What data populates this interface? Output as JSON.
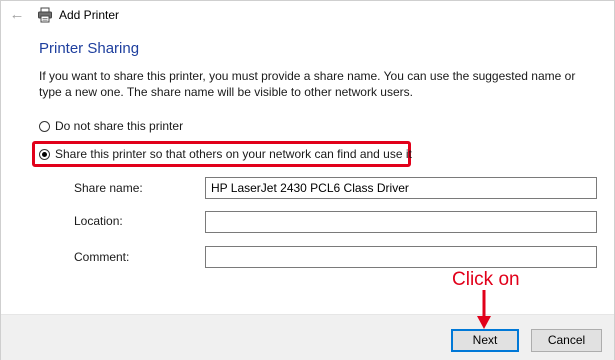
{
  "window": {
    "title": "Add Printer",
    "back_glyph": "←"
  },
  "page": {
    "heading": "Printer Sharing",
    "description": "If you want to share this printer, you must provide a share name. You can use the suggested name or type a new one. The share name will be visible to other network users."
  },
  "sharing_options": {
    "no_share_label": "Do not share this printer",
    "share_label": "Share this printer so that others on your network can find and use it",
    "selected": "share"
  },
  "fields": {
    "share_name_label": "Share name:",
    "share_name_value": "HP LaserJet 2430 PCL6 Class Driver",
    "location_label": "Location:",
    "location_value": "",
    "comment_label": "Comment:",
    "comment_value": ""
  },
  "buttons": {
    "next_label": "Next",
    "cancel_label": "Cancel"
  },
  "annotation": {
    "text": "Click on",
    "color": "#e1001a"
  },
  "colors": {
    "heading": "#1e3f9e",
    "focus_border": "#0078d7",
    "highlight": "#e1001a"
  },
  "icons": {
    "back": "back-arrow-icon",
    "printer": "printer-icon",
    "annotation_arrow": "red-down-arrow-icon"
  }
}
